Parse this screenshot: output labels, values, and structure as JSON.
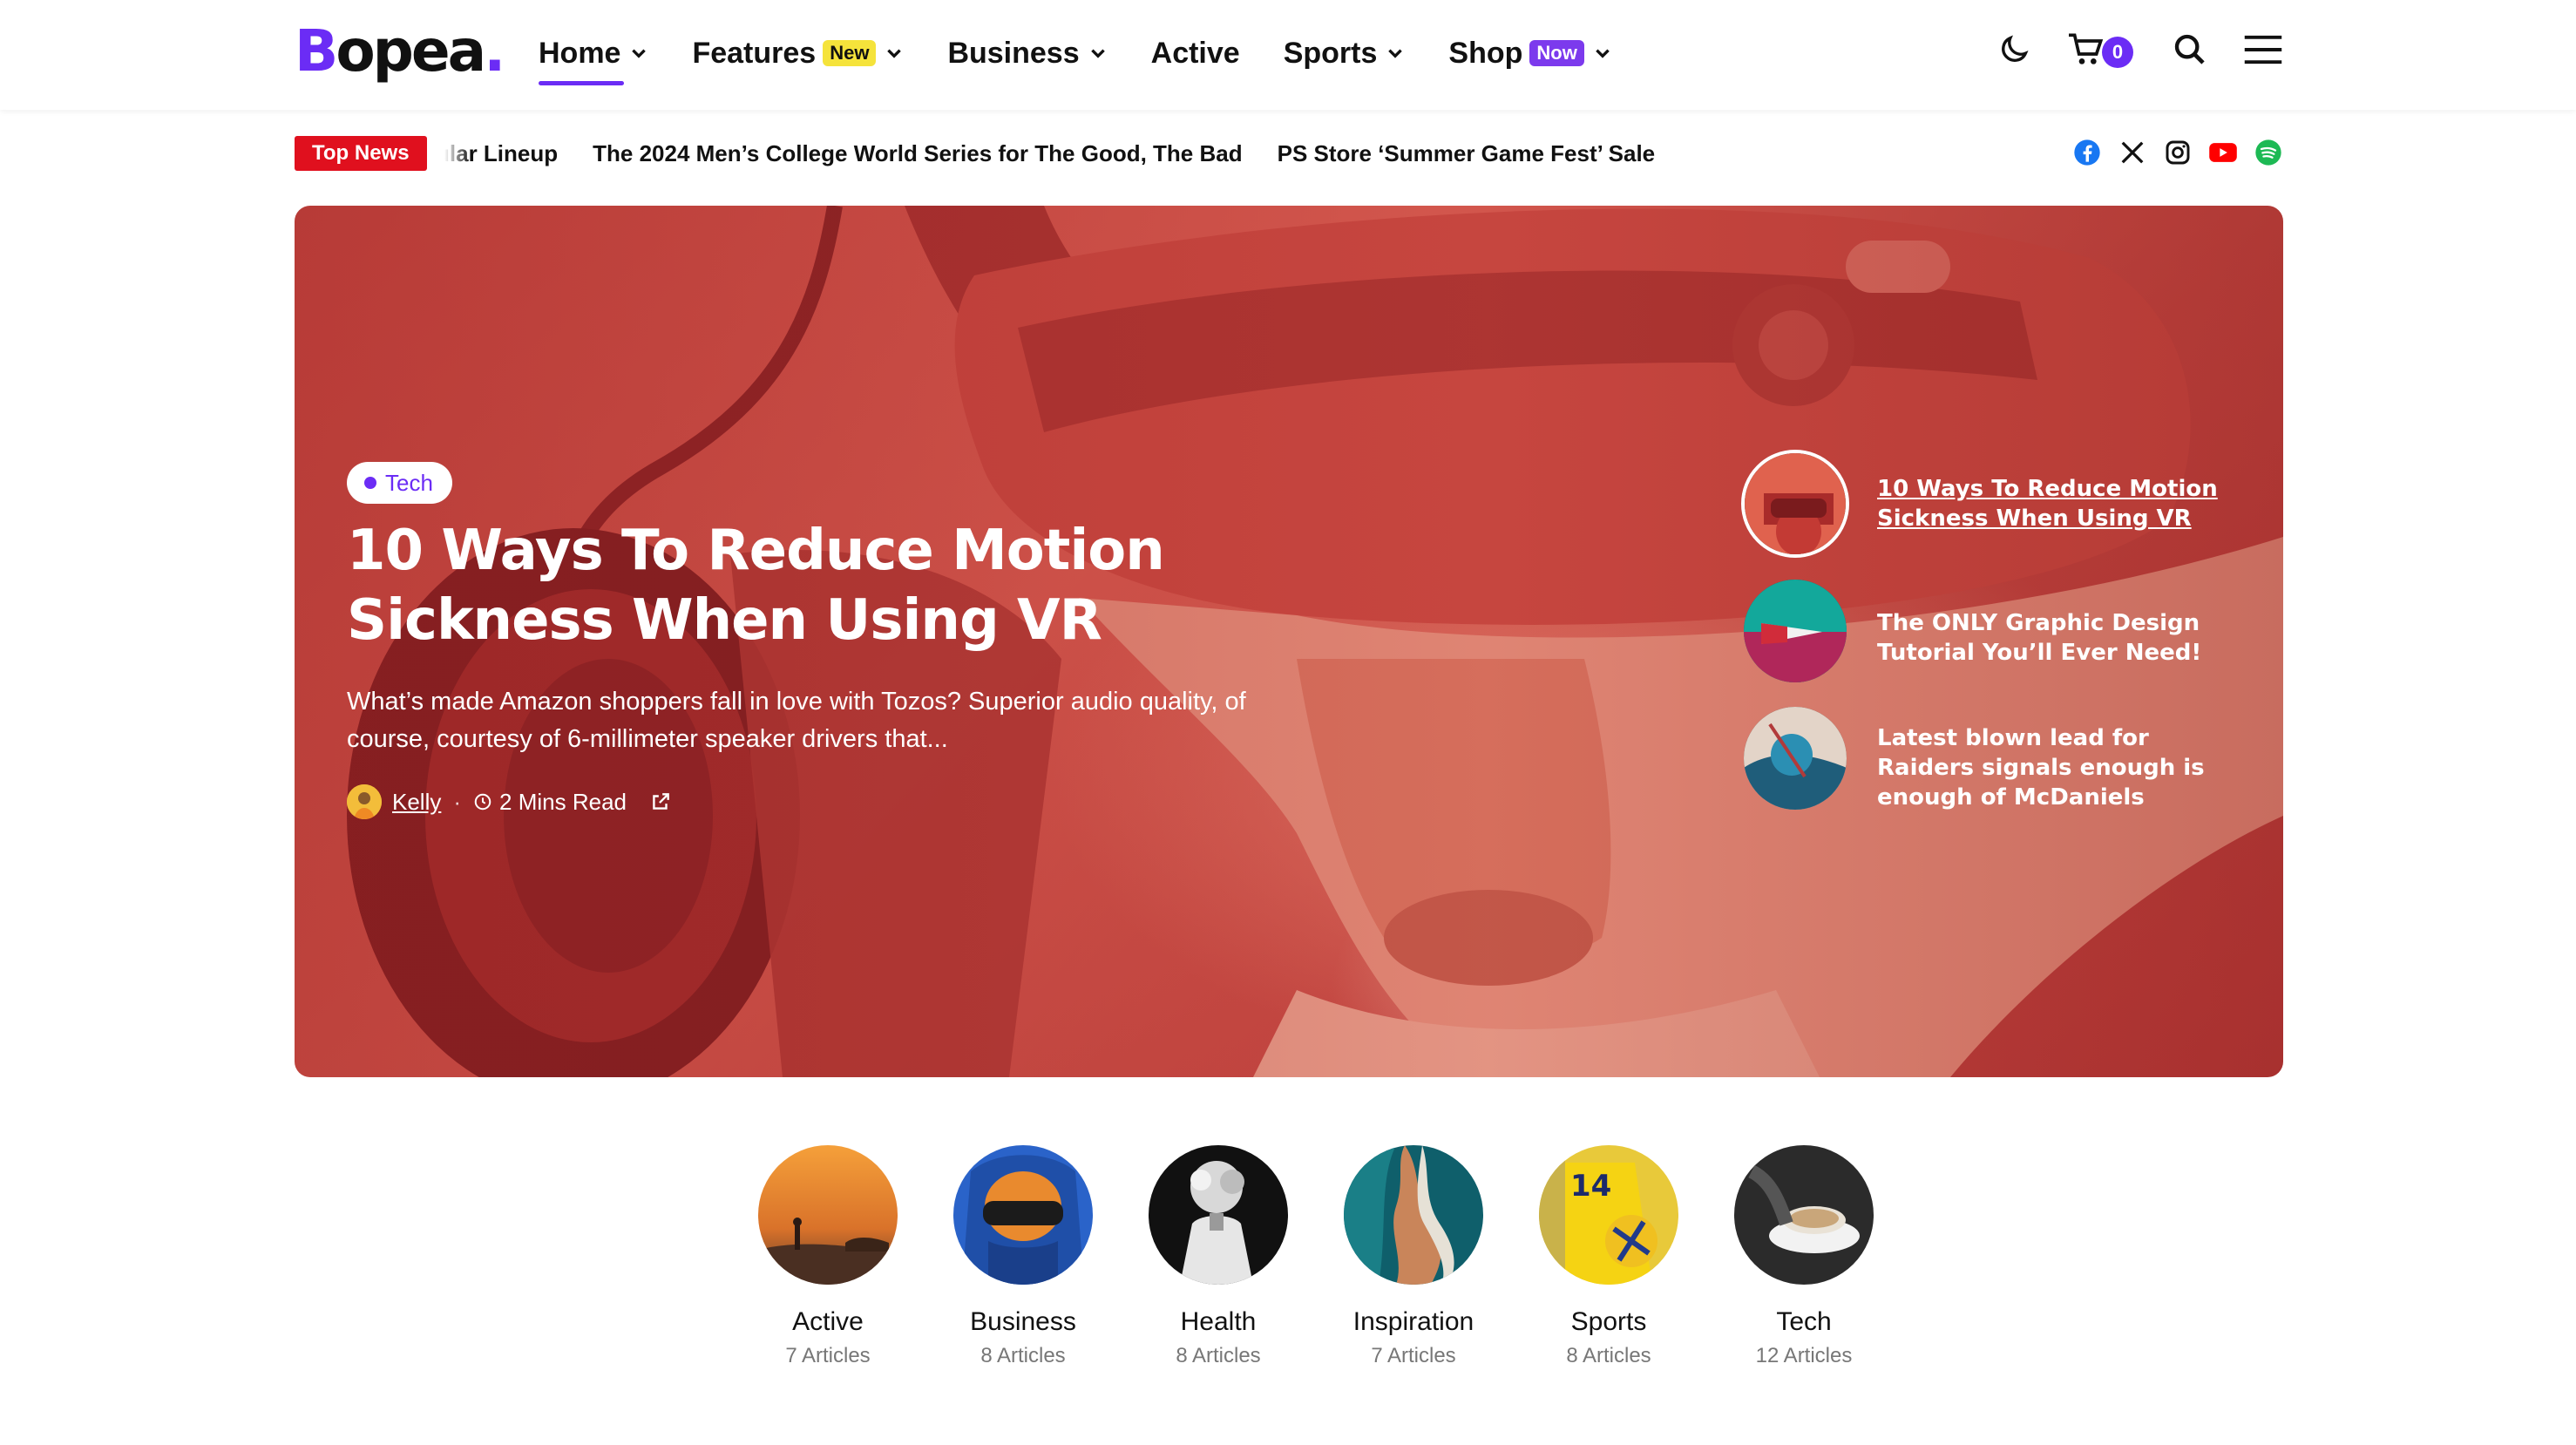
{
  "brand": {
    "name": "Bopea",
    "accent": "#6b2cf5"
  },
  "nav": {
    "items": [
      {
        "label": "Home",
        "dropdown": true,
        "active": true
      },
      {
        "label": "Features",
        "badge": "New",
        "dropdown": true
      },
      {
        "label": "Business",
        "dropdown": true
      },
      {
        "label": "Active",
        "dropdown": false
      },
      {
        "label": "Sports",
        "dropdown": true
      },
      {
        "label": "Shop",
        "badge": "Now",
        "dropdown": true
      }
    ],
    "cart_count": "0",
    "icons": [
      "moon-icon",
      "cart-icon",
      "search-icon",
      "menu-icon"
    ]
  },
  "ticker": {
    "label": "Top News",
    "items": [
      "ular Lineup",
      "The 2024 Men’s College World Series for The Good, The Bad",
      "PS Store ‘Summer Game Fest’ Sale"
    ],
    "socials": [
      "facebook-icon",
      "x-icon",
      "instagram-icon",
      "youtube-icon",
      "spotify-icon"
    ]
  },
  "hero": {
    "tag": "Tech",
    "title": "10 Ways To Reduce Motion Sickness When Using VR",
    "excerpt": "What’s made Amazon shoppers fall in love with Tozos? Superior audio quality, of course, courtesy of 6-millimeter speaker drivers that...",
    "author": "Kelly",
    "read_time": "2 Mins Read",
    "side_posts": [
      {
        "title": "10 Ways To Reduce Motion Sickness When Using VR"
      },
      {
        "title": "The ONLY Graphic Design Tutorial You’ll Ever Need!"
      },
      {
        "title": "Latest blown lead for Raiders signals enough is enough of McDaniels"
      }
    ]
  },
  "categories": [
    {
      "name": "Active",
      "count": "7 Articles"
    },
    {
      "name": "Business",
      "count": "8 Articles"
    },
    {
      "name": "Health",
      "count": "8 Articles"
    },
    {
      "name": "Inspiration",
      "count": "7 Articles"
    },
    {
      "name": "Sports",
      "count": "8 Articles"
    },
    {
      "name": "Tech",
      "count": "12 Articles"
    }
  ]
}
